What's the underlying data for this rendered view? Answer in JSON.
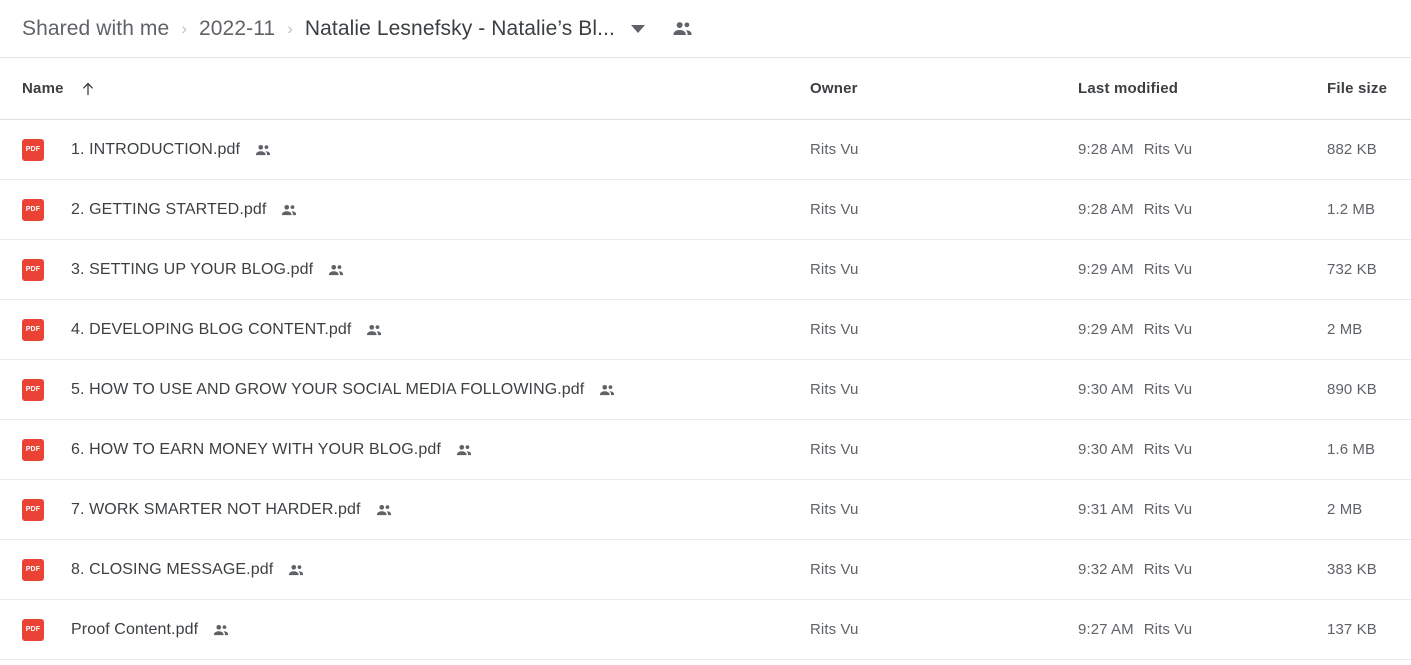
{
  "breadcrumb": {
    "items": [
      {
        "label": "Shared with me",
        "active": false
      },
      {
        "label": "2022-11",
        "active": false
      },
      {
        "label": "Natalie Lesnefsky - Natalie’s Bl...",
        "active": true
      }
    ],
    "separator": "›",
    "dropdown_icon": "chevron-down-icon",
    "shared_icon": "people-icon"
  },
  "table": {
    "columns": {
      "name": "Name",
      "owner": "Owner",
      "modified": "Last modified",
      "size": "File size"
    },
    "sort": {
      "column": "Name",
      "direction": "ascending",
      "icon": "arrow-up-icon"
    },
    "rows": [
      {
        "icon": "pdf-file-icon",
        "icon_label": "PDF",
        "name": "1. INTRODUCTION.pdf",
        "shared": true,
        "owner": "Rits Vu",
        "modified_time": "9:28 AM",
        "modified_by": "Rits Vu",
        "size": "882 KB"
      },
      {
        "icon": "pdf-file-icon",
        "icon_label": "PDF",
        "name": "2. GETTING STARTED.pdf",
        "shared": true,
        "owner": "Rits Vu",
        "modified_time": "9:28 AM",
        "modified_by": "Rits Vu",
        "size": "1.2 MB"
      },
      {
        "icon": "pdf-file-icon",
        "icon_label": "PDF",
        "name": "3. SETTING UP YOUR BLOG.pdf",
        "shared": true,
        "owner": "Rits Vu",
        "modified_time": "9:29 AM",
        "modified_by": "Rits Vu",
        "size": "732 KB"
      },
      {
        "icon": "pdf-file-icon",
        "icon_label": "PDF",
        "name": "4. DEVELOPING BLOG CONTENT.pdf",
        "shared": true,
        "owner": "Rits Vu",
        "modified_time": "9:29 AM",
        "modified_by": "Rits Vu",
        "size": "2 MB"
      },
      {
        "icon": "pdf-file-icon",
        "icon_label": "PDF",
        "name": "5. HOW TO USE AND GROW YOUR SOCIAL MEDIA FOLLOWING.pdf",
        "shared": true,
        "owner": "Rits Vu",
        "modified_time": "9:30 AM",
        "modified_by": "Rits Vu",
        "size": "890 KB"
      },
      {
        "icon": "pdf-file-icon",
        "icon_label": "PDF",
        "name": "6. HOW TO EARN MONEY WITH YOUR BLOG.pdf",
        "shared": true,
        "owner": "Rits Vu",
        "modified_time": "9:30 AM",
        "modified_by": "Rits Vu",
        "size": "1.6 MB"
      },
      {
        "icon": "pdf-file-icon",
        "icon_label": "PDF",
        "name": "7. WORK SMARTER NOT HARDER.pdf",
        "shared": true,
        "owner": "Rits Vu",
        "modified_time": "9:31 AM",
        "modified_by": "Rits Vu",
        "size": "2 MB"
      },
      {
        "icon": "pdf-file-icon",
        "icon_label": "PDF",
        "name": "8. CLOSING MESSAGE.pdf",
        "shared": true,
        "owner": "Rits Vu",
        "modified_time": "9:32 AM",
        "modified_by": "Rits Vu",
        "size": "383 KB"
      },
      {
        "icon": "pdf-file-icon",
        "icon_label": "PDF",
        "name": "Proof Content.pdf",
        "shared": true,
        "owner": "Rits Vu",
        "modified_time": "9:27 AM",
        "modified_by": "Rits Vu",
        "size": "137 KB"
      }
    ]
  },
  "colors": {
    "pdf_red": "#ea4335",
    "text_primary": "#3c4043",
    "text_secondary": "#5f6368",
    "divider": "#e8eaed",
    "icon_gray": "#5f6368"
  }
}
